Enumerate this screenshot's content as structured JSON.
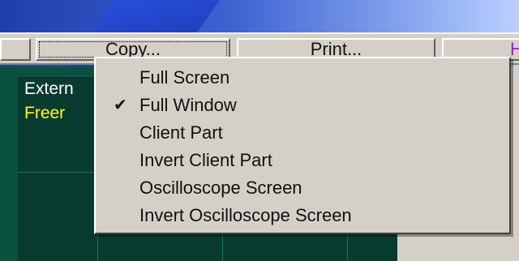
{
  "toolbar": {
    "copy_label": "Copy...",
    "print_label": "Print...",
    "right_partial": "H"
  },
  "scope": {
    "line1": "Extern",
    "line2": "Freer"
  },
  "copy_menu": {
    "items": [
      {
        "label": "Full Screen",
        "checked": false
      },
      {
        "label": "Full Window",
        "checked": true,
        "check_glyph": "✔"
      },
      {
        "label": "Client Part",
        "checked": false
      },
      {
        "label": "Invert Client Part",
        "checked": false
      },
      {
        "label": "Oscilloscope Screen",
        "checked": false
      },
      {
        "label": "Invert Oscilloscope Screen",
        "checked": false
      }
    ]
  },
  "colors": {
    "menu_bg": "#d4d0c8",
    "scope_bg": "#0b5140",
    "trigger_text": "#ffff00",
    "accent_text": "#a020c0"
  }
}
